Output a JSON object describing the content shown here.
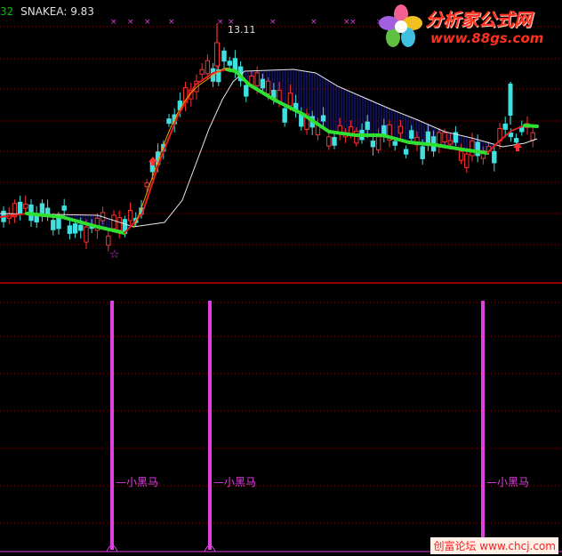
{
  "header": {
    "cut_prefix": "32",
    "indicator": "SNAKEA: 9.83"
  },
  "upper_panel": {
    "peak_label": "13.11",
    "star_glyph": "☆"
  },
  "lower_panel": {
    "signal_label": "小黑马",
    "signals": [
      {
        "label": "小黑马"
      },
      {
        "label": "小黑马"
      },
      {
        "label": "小黑马"
      }
    ]
  },
  "watermark": {
    "title": "分析家公式网",
    "url": "www.88gs.com"
  },
  "footer": {
    "text": "创富论坛 www.chcj.com"
  },
  "colors": {
    "background": "#000000",
    "grid": "#8b0000",
    "divider": "#c00000",
    "signal": "#e040e0",
    "up": "#ff3030",
    "down": "#40e0e0",
    "snake_up": "#e02020",
    "snake_down": "#30e030",
    "ribbon": "#2020a0"
  }
}
